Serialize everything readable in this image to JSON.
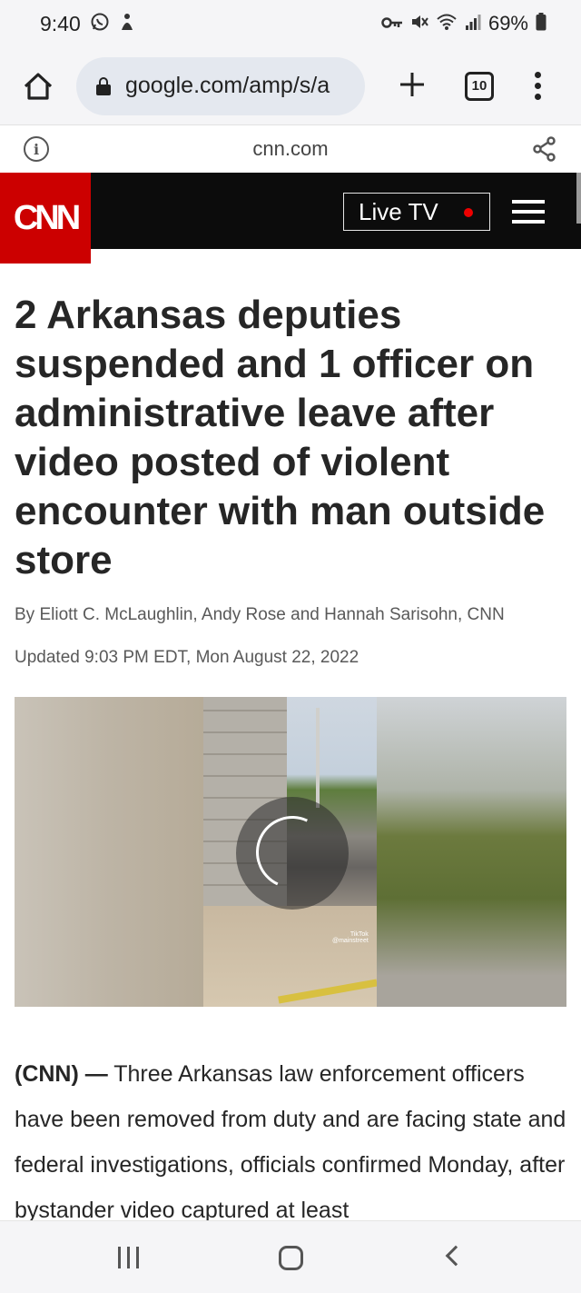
{
  "status_bar": {
    "time": "9:40",
    "battery": "69%",
    "left_icons": [
      "whatsapp-icon",
      "notification-icon"
    ],
    "right_icons": [
      "key-icon",
      "mute-icon",
      "wifi-icon",
      "signal-icon",
      "battery-icon"
    ]
  },
  "browser": {
    "url": "google.com/amp/s/a",
    "tab_count": "10",
    "amp_domain": "cnn.com"
  },
  "site_header": {
    "logo_text": "CNN",
    "live_tv_label": "Live TV",
    "brand_color": "#cc0000",
    "live_dot_color": "#e00000"
  },
  "article": {
    "headline": "2 Arkansas deputies suspended and 1 officer on administrative leave after video posted of violent encounter with man outside store",
    "byline": "By Eliott C. McLaughlin, Andy Rose and Hannah Sarisohn, CNN",
    "updated": "Updated 9:03 PM EDT, Mon August 22, 2022",
    "video_watermark": "TikTok",
    "video_credit": "@mainstreet",
    "body_lead": "(CNN) —",
    "body_text": " Three Arkansas law enforcement officers have been removed from duty and are facing state and federal investigations, officials confirmed Monday, after bystander video captured at least"
  },
  "nav_bar": {
    "buttons": [
      "recent-apps",
      "home",
      "back"
    ]
  }
}
